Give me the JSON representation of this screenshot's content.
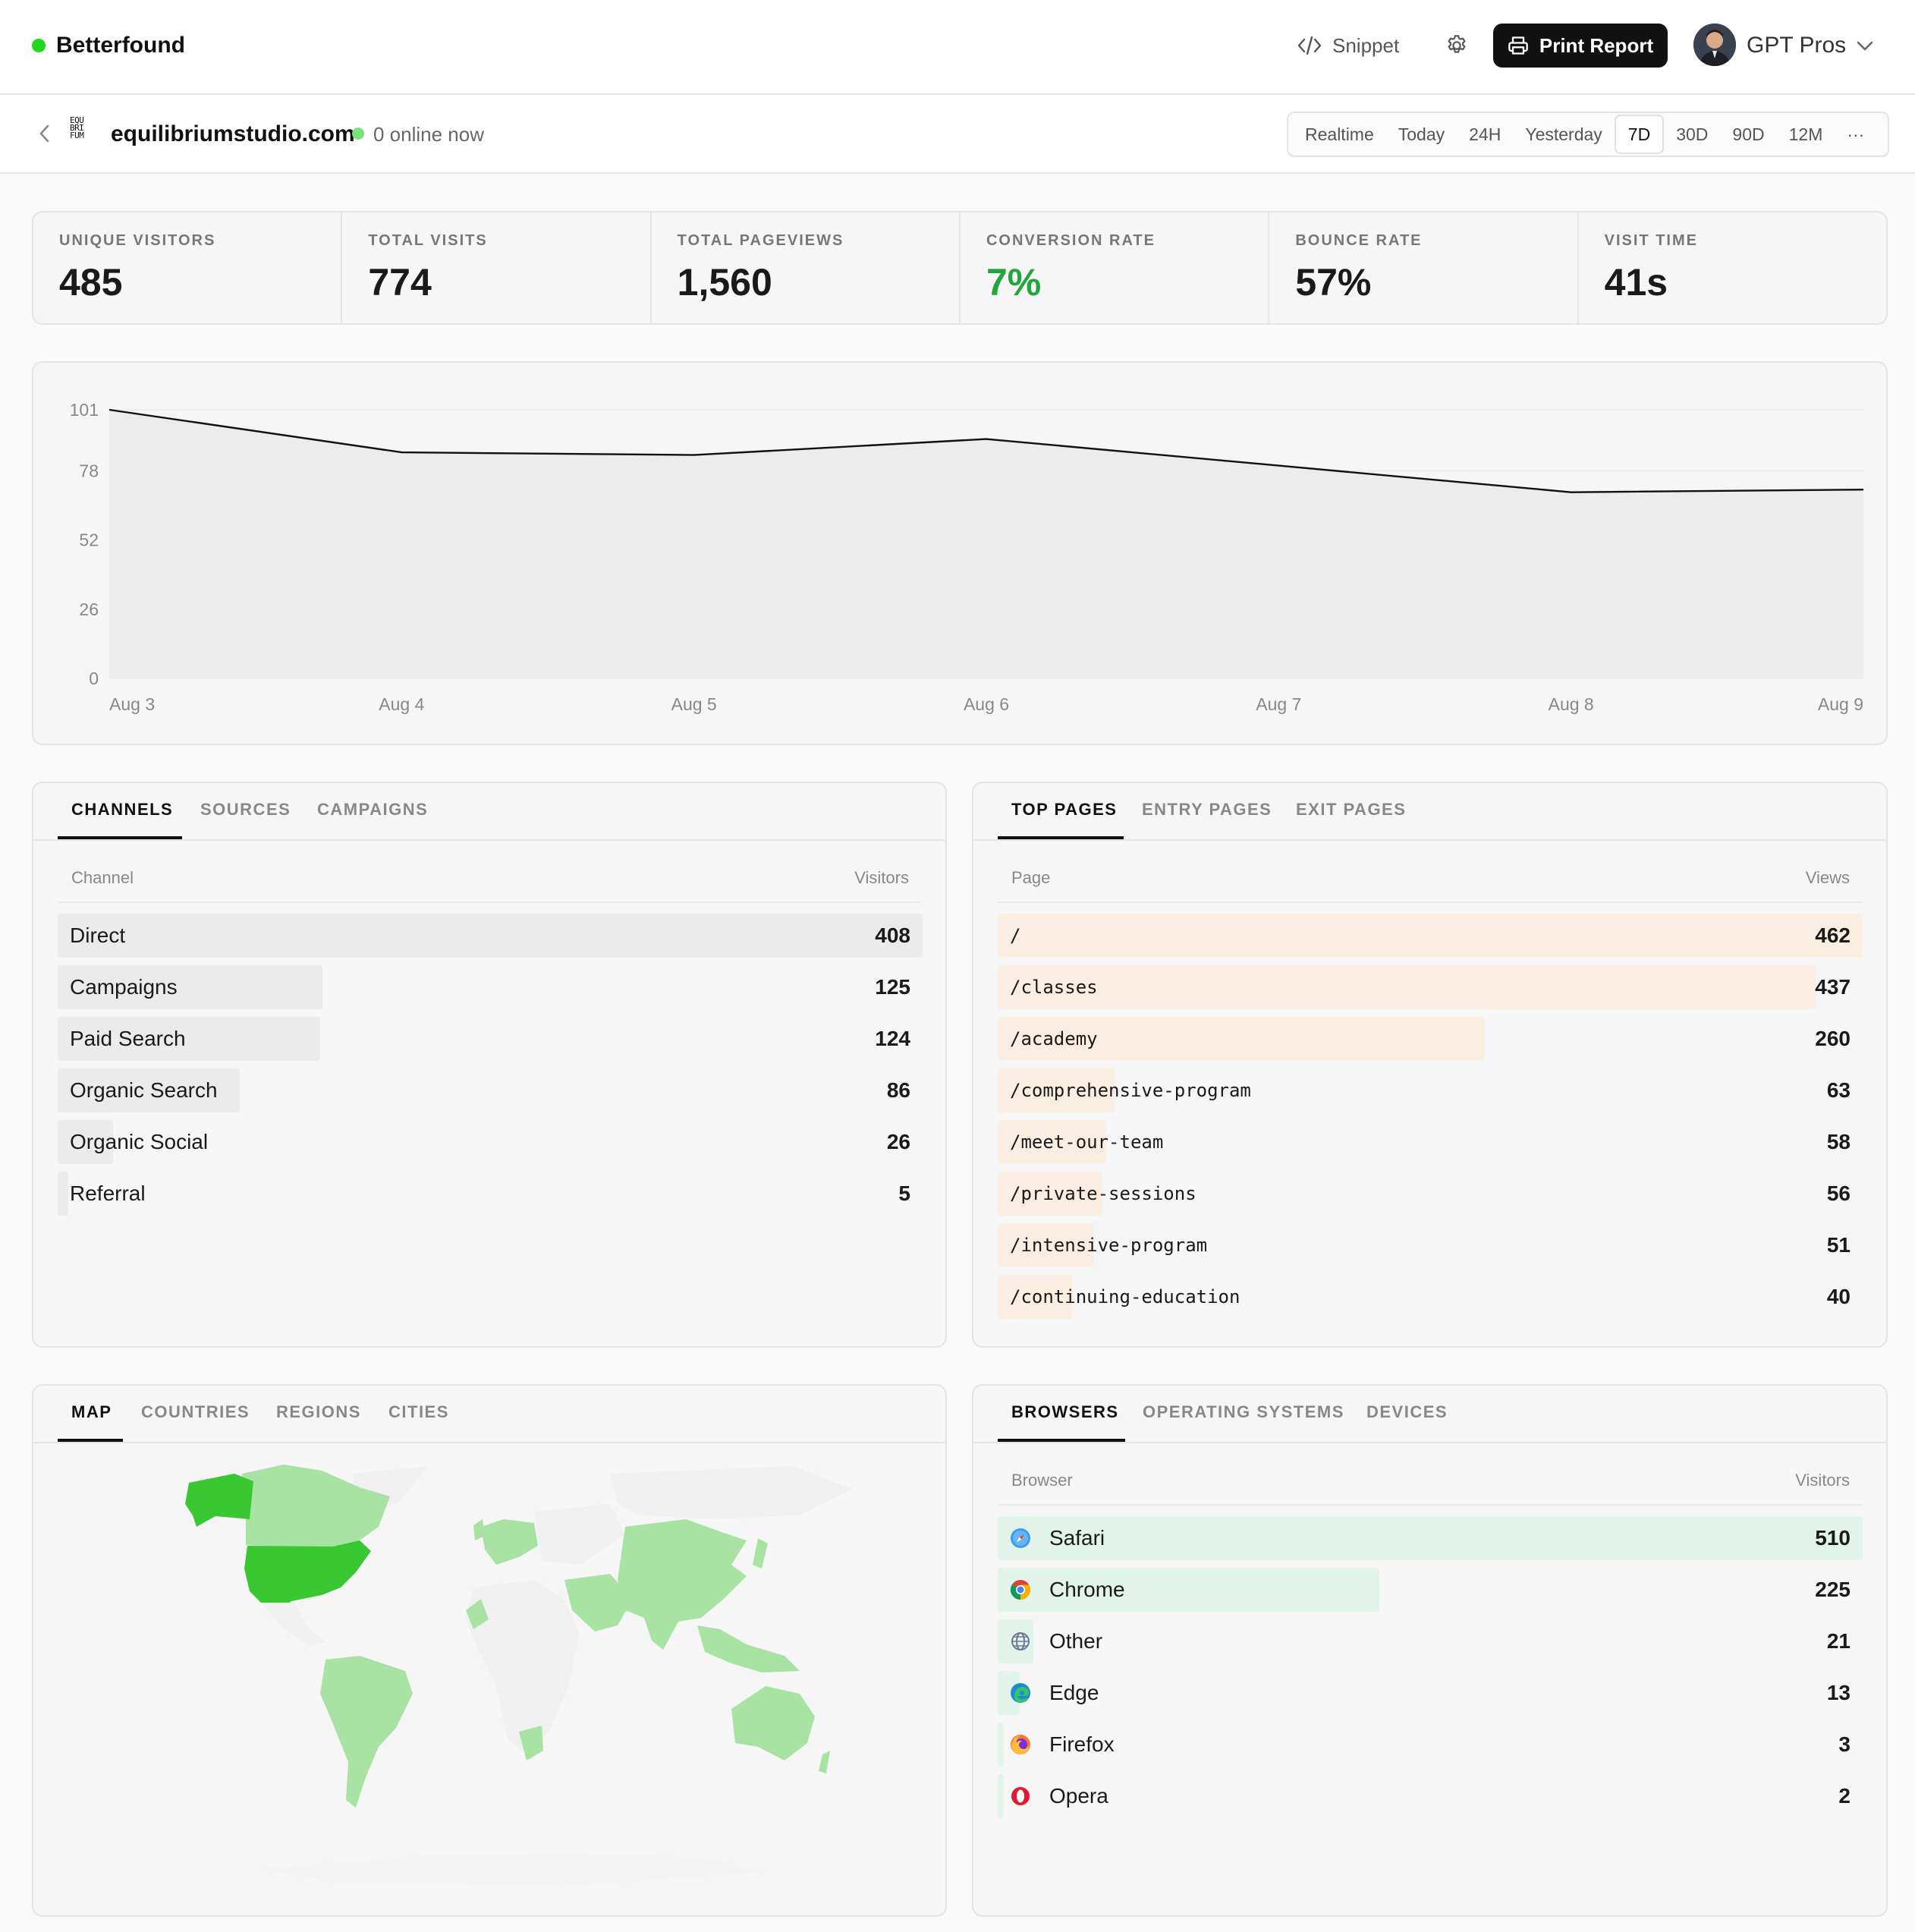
{
  "header": {
    "brand": "Betterfound",
    "snippet_label": "Snippet",
    "print_label": "Print Report",
    "user_name": "GPT Pros"
  },
  "site": {
    "logo_text": "EQU BRI FUM",
    "name": "equilibriumstudio.com",
    "online_text": "0 online now",
    "ranges": [
      "Realtime",
      "Today",
      "24H",
      "Yesterday",
      "7D",
      "30D",
      "90D",
      "12M",
      "···"
    ],
    "active_range": "7D"
  },
  "stats": [
    {
      "label": "UNIQUE VISITORS",
      "value": "485"
    },
    {
      "label": "TOTAL VISITS",
      "value": "774"
    },
    {
      "label": "TOTAL PAGEVIEWS",
      "value": "1,560"
    },
    {
      "label": "CONVERSION RATE",
      "value": "7%"
    },
    {
      "label": "BOUNCE RATE",
      "value": "57%"
    },
    {
      "label": "VISIT TIME",
      "value": "41s"
    }
  ],
  "chart_data": {
    "type": "area",
    "x": [
      "Aug 3",
      "Aug 4",
      "Aug 5",
      "Aug 6",
      "Aug 7",
      "Aug 8",
      "Aug 9"
    ],
    "series": [
      {
        "values": [
          101,
          85,
          84,
          90,
          80,
          70,
          71
        ]
      }
    ],
    "ylim": [
      0,
      101
    ],
    "yticks": [
      0,
      26,
      52,
      78,
      101
    ],
    "grid": true,
    "colors": {
      "line": "#111111",
      "fill": "#ececec"
    }
  },
  "channels": {
    "tabs": [
      "CHANNELS",
      "SOURCES",
      "CAMPAIGNS"
    ],
    "col_label": "Channel",
    "col_value": "Visitors",
    "bar_color": "#ebebeb",
    "rows": [
      {
        "label": "Direct",
        "value": 408
      },
      {
        "label": "Campaigns",
        "value": 125
      },
      {
        "label": "Paid Search",
        "value": 124
      },
      {
        "label": "Organic Search",
        "value": 86
      },
      {
        "label": "Organic Social",
        "value": 26
      },
      {
        "label": "Referral",
        "value": 5
      }
    ]
  },
  "pages": {
    "tabs": [
      "TOP PAGES",
      "ENTRY PAGES",
      "EXIT PAGES"
    ],
    "col_label": "Page",
    "col_value": "Views",
    "bar_color": "#faeee2",
    "rows": [
      {
        "label": "/",
        "value": 462
      },
      {
        "label": "/classes",
        "value": 437
      },
      {
        "label": "/academy",
        "value": 260
      },
      {
        "label": "/comprehensive-program",
        "value": 63
      },
      {
        "label": "/meet-our-team",
        "value": 58
      },
      {
        "label": "/private-sessions",
        "value": 56
      },
      {
        "label": "/intensive-program",
        "value": 51
      },
      {
        "label": "/continuing-education",
        "value": 40
      }
    ]
  },
  "geo": {
    "tabs": [
      "MAP",
      "COUNTRIES",
      "REGIONS",
      "CITIES"
    ],
    "colors": {
      "high": "#3ac832",
      "medium": "#a8e3a3",
      "none": "#f0f0f0"
    }
  },
  "browsers": {
    "tabs": [
      "BROWSERS",
      "OPERATING SYSTEMS",
      "DEVICES"
    ],
    "col_label": "Browser",
    "col_value": "Visitors",
    "bar_color": "#e2f3ea",
    "rows": [
      {
        "label": "Safari",
        "value": 510,
        "icon": "safari-icon"
      },
      {
        "label": "Chrome",
        "value": 225,
        "icon": "chrome-icon"
      },
      {
        "label": "Other",
        "value": 21,
        "icon": "globe-icon"
      },
      {
        "label": "Edge",
        "value": 13,
        "icon": "edge-icon"
      },
      {
        "label": "Firefox",
        "value": 3,
        "icon": "firefox-icon"
      },
      {
        "label": "Opera",
        "value": 2,
        "icon": "opera-icon"
      }
    ]
  }
}
